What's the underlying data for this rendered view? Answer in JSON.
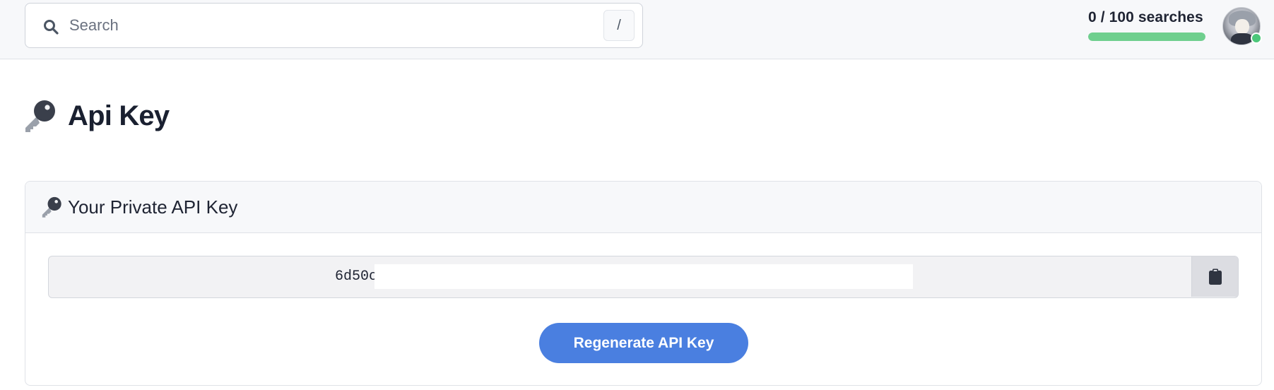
{
  "search": {
    "placeholder": "Search",
    "value": "",
    "shortcut": "/",
    "icon": "search-icon"
  },
  "quota": {
    "text": "0 / 100 searches",
    "used": 0,
    "limit": 100,
    "bar_fill_fraction": 1.0,
    "bar_color": "#6fcf8e"
  },
  "user": {
    "avatar": "anime-avatar",
    "status": "online",
    "status_color": "#4cc77a"
  },
  "page": {
    "title": "Api Key",
    "title_icon": "key-icon"
  },
  "api_key_card": {
    "header_title": "Your Private API Key",
    "header_icon": "key-icon",
    "key_value_visible": "6d50c",
    "copy_icon": "clipboard-icon",
    "regenerate_label": "Regenerate API Key",
    "accent_color": "#4a7fe0"
  }
}
